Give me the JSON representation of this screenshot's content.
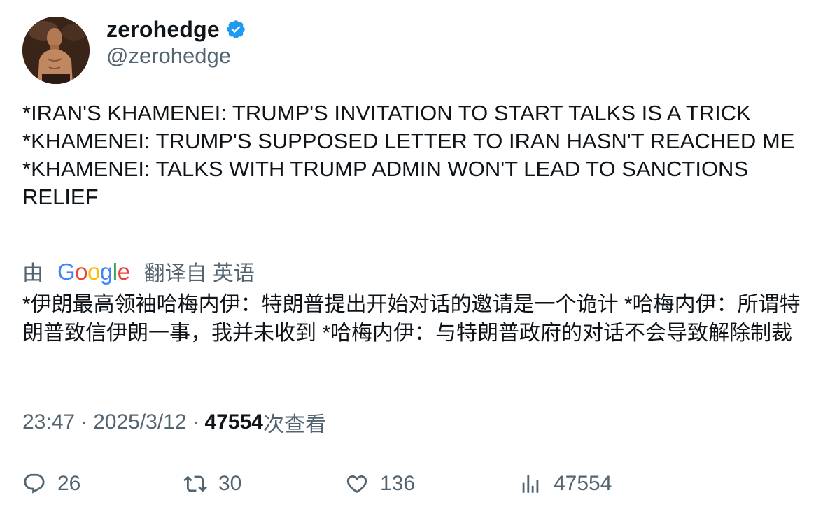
{
  "author": {
    "display_name": "zerohedge",
    "handle": "@zerohedge",
    "verified": true,
    "verified_color": "#1d9bf0"
  },
  "tweet": {
    "lines": [
      "*IRAN'S KHAMENEI: TRUMP'S INVITATION TO START TALKS IS A TRICK",
      "*KHAMENEI: TRUMP'S SUPPOSED LETTER TO IRAN HASN'T REACHED ME",
      "*KHAMENEI: TALKS WITH TRUMP ADMIN WON'T LEAD TO SANCTIONS RELIEF"
    ]
  },
  "translation": {
    "prefix": "由",
    "provider": "Google",
    "suffix": "翻译自 英语",
    "text": "*伊朗最高领袖哈梅内伊：特朗普提出开始对话的邀请是一个诡计 *哈梅内伊：所谓特朗普致信伊朗一事，我并未收到 *哈梅内伊：与特朗普政府的对话不会导致解除制裁"
  },
  "meta": {
    "time": "23:47",
    "separator": "·",
    "date": "2025/3/12",
    "views_count": "47554",
    "views_label": "次查看"
  },
  "actions": {
    "replies": "26",
    "retweets": "30",
    "likes": "136",
    "views": "47554"
  },
  "colors": {
    "text_primary": "#0f1419",
    "text_secondary": "#536471"
  }
}
